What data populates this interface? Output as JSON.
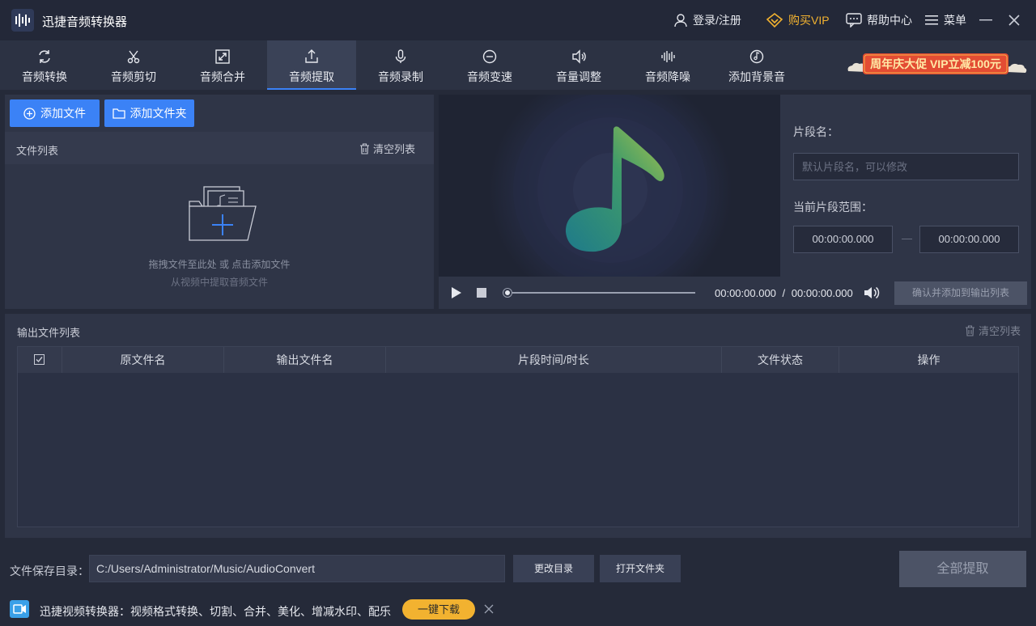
{
  "app": {
    "title": "迅捷音频转换器"
  },
  "titlebar": {
    "login": "登录/注册",
    "vip": "购买VIP",
    "help": "帮助中心",
    "menu": "菜单"
  },
  "tabs": [
    {
      "label": "音频转换",
      "icon": "refresh-icon"
    },
    {
      "label": "音频剪切",
      "icon": "scissors-icon"
    },
    {
      "label": "音频合并",
      "icon": "merge-icon"
    },
    {
      "label": "音频提取",
      "icon": "upload-icon",
      "active": true
    },
    {
      "label": "音频录制",
      "icon": "microphone-icon"
    },
    {
      "label": "音频变速",
      "icon": "speed-icon"
    },
    {
      "label": "音量调整",
      "icon": "volume-icon"
    },
    {
      "label": "音频降噪",
      "icon": "waveform-icon"
    },
    {
      "label": "添加背景音",
      "icon": "music-disc-icon"
    }
  ],
  "promo": {
    "text": "周年庆大促 VIP立减100元"
  },
  "file_panel": {
    "add_file": "添加文件",
    "add_folder": "添加文件夹",
    "list_title": "文件列表",
    "clear": "清空列表",
    "hint_primary": "拖拽文件至此处 或 点击添加文件",
    "hint_secondary": "从视频中提取音频文件"
  },
  "segment": {
    "name_label": "片段名：",
    "name_placeholder": "默认片段名，可以修改",
    "range_label": "当前片段范围：",
    "start": "00:00:00.000",
    "end": "00:00:00.000",
    "dash": "—"
  },
  "player": {
    "current": "00:00:00.000",
    "separator": "/",
    "total": "00:00:00.000",
    "confirm": "确认并添加到输出列表",
    "progress": 0
  },
  "output": {
    "title": "输出文件列表",
    "clear": "清空列表",
    "columns": [
      "原文件名",
      "输出文件名",
      "片段时间/时长",
      "文件状态",
      "操作"
    ]
  },
  "bottom": {
    "save_label": "文件保存目录：",
    "save_path": "C:/Users/Administrator/Music/AudioConvert",
    "change_dir": "更改目录",
    "open_folder": "打开文件夹",
    "extract_all": "全部提取"
  },
  "ad": {
    "text": "迅捷视频转换器：视频格式转换、切割、合并、美化、增减水印、配乐",
    "button": "一键下载"
  },
  "colors": {
    "accent": "#3b82f6",
    "vip": "#f2b230",
    "background": "#252a39",
    "panel": "#2f3547"
  }
}
